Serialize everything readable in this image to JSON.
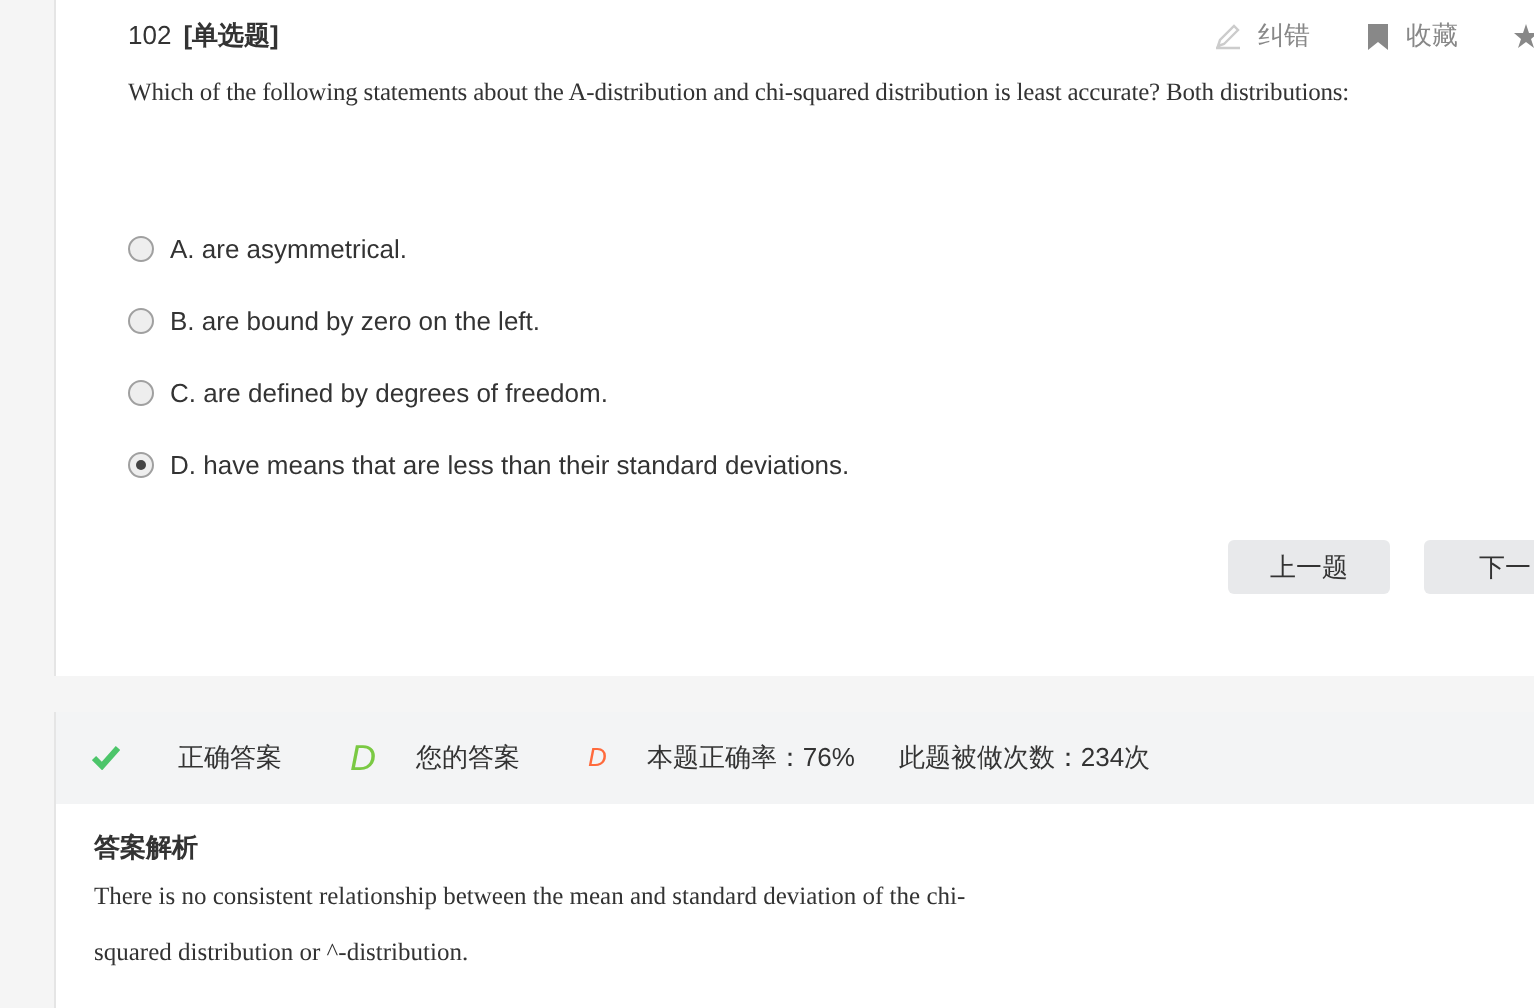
{
  "question": {
    "number": "102",
    "type": "[单选题]",
    "text": "Which of the following statements about the A-distribution and chi-squared distribution is least accurate? Both distributions:"
  },
  "actions": [
    {
      "kind": "edit",
      "label": "纠错"
    },
    {
      "kind": "bookmark",
      "label": "收藏"
    },
    {
      "kind": "star"
    }
  ],
  "options": [
    {
      "label": "A. are asymmetrical.",
      "selected": false
    },
    {
      "label": "B. are bound by zero on the left.",
      "selected": false
    },
    {
      "label": "C. are defined by degrees of freedom.",
      "selected": false
    },
    {
      "label": "D. have means that are less than their standard deviations.",
      "selected": true
    }
  ],
  "nav_buttons": [
    "上一题",
    "下一"
  ],
  "result": {
    "correct_label": "正确答案",
    "correct_answer": "D",
    "your_label": "您的答案",
    "your_answer": "D",
    "accuracy": "本题正确率：76%",
    "attempts": "此题被做次数：234次"
  },
  "explanation": {
    "title": "答案解析",
    "lines": [
      "There is no consistent relationship between the mean and standard deviation of the chi-",
      "squared distribution or ^-distribution."
    ]
  }
}
